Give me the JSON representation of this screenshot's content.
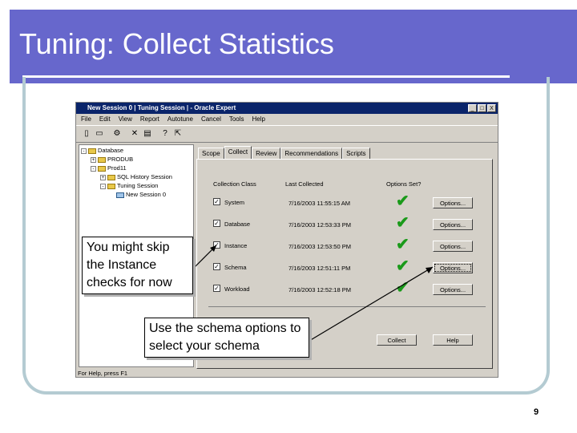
{
  "slide": {
    "title": "Tuning: Collect Statistics",
    "page_number": "9",
    "callout_instance": "You might skip the Instance checks for now",
    "callout_schema": "Use the schema options to select your schema"
  },
  "window": {
    "title": "New Session 0 | Tuning Session | - Oracle Expert",
    "controls": [
      "_",
      "□",
      "X"
    ],
    "menu": [
      "File",
      "Edit",
      "View",
      "Report",
      "Autotune",
      "Cancel",
      "Tools",
      "Help"
    ],
    "status": "For Help, press F1"
  },
  "tree": {
    "items": [
      {
        "label": "Database",
        "toggle": "-"
      },
      {
        "label": "PRODUB",
        "toggle": "+"
      },
      {
        "label": "Prod11",
        "toggle": "-"
      },
      {
        "label": "SQL History Session",
        "toggle": "+"
      },
      {
        "label": "Tuning Session",
        "toggle": "-"
      },
      {
        "label": "New Session 0",
        "toggle": ""
      }
    ]
  },
  "tabs": [
    "Scope",
    "Collect",
    "Review",
    "Recommendations",
    "Scripts"
  ],
  "collect": {
    "headers": {
      "class": "Collection Class",
      "last": "Last Collected",
      "options_set": "Options Set?"
    },
    "rows": [
      {
        "class": "System",
        "last": "7/16/2003 11:55:15 AM",
        "option": "Options..."
      },
      {
        "class": "Database",
        "last": "7/16/2003 12:53:33 PM",
        "option": "Options..."
      },
      {
        "class": "Instance",
        "last": "7/16/2003 12:53:50 PM",
        "option": "Options..."
      },
      {
        "class": "Schema",
        "last": "7/16/2003 12:51:11 PM",
        "option": "Options..."
      },
      {
        "class": "Workload",
        "last": "7/16/2003 12:52:18 PM",
        "option": "Options..."
      }
    ],
    "collect_button": "Collect",
    "help_button": "Help"
  }
}
